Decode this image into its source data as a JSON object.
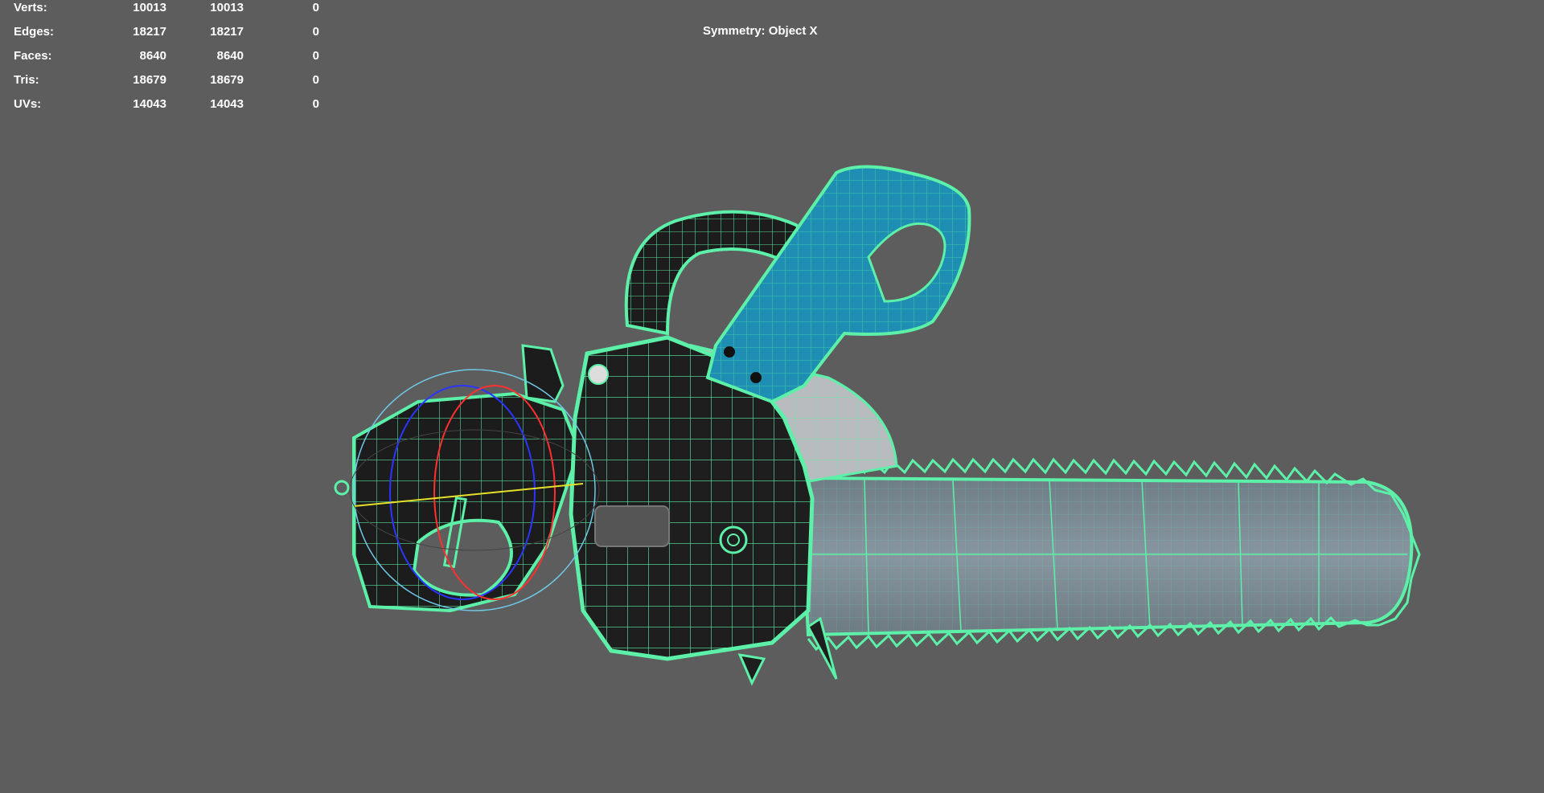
{
  "hud": {
    "rows": [
      {
        "label": "Verts:",
        "v1": "10013",
        "v2": "10013",
        "v3": "0"
      },
      {
        "label": "Edges:",
        "v1": "18217",
        "v2": "18217",
        "v3": "0"
      },
      {
        "label": "Faces:",
        "v1": "8640",
        "v2": "8640",
        "v3": "0"
      },
      {
        "label": "Tris:",
        "v1": "18679",
        "v2": "18679",
        "v3": "0"
      },
      {
        "label": "UVs:",
        "v1": "14043",
        "v2": "14043",
        "v3": "0"
      }
    ]
  },
  "symmetry": {
    "text": "Symmetry: Object X"
  },
  "colors": {
    "viewport_bg": "#5d5d5d",
    "wireframe": "#5cf0a8",
    "handle_blue": "#1e8fb3",
    "body_dark": "#1c1c1c",
    "bar_gray": "#7d8c96"
  },
  "viewport": {
    "object": "chainsaw-model",
    "manipulator": "rotate-gizmo"
  }
}
